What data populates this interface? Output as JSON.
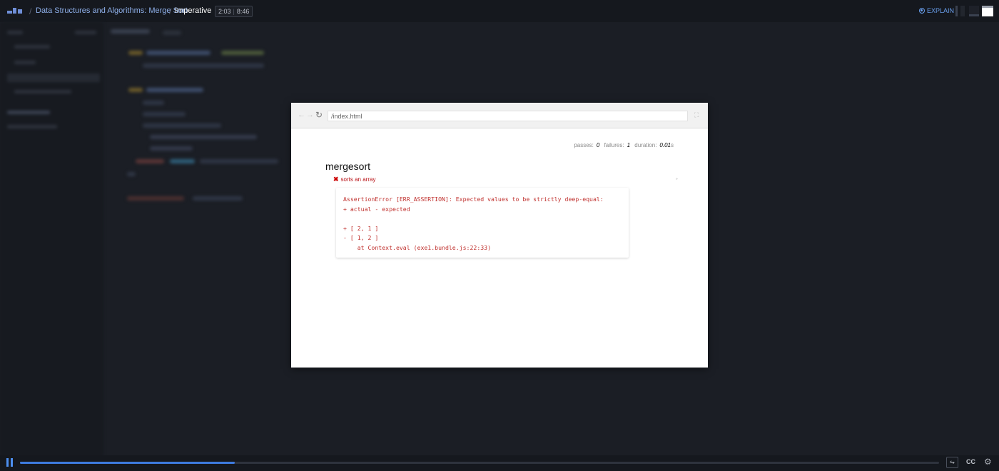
{
  "header": {
    "course_title": "Data Structures and Algorithms: Merge Sort",
    "lesson_title": "Imperative",
    "current_time": "2:03",
    "total_time": "8:46",
    "explain_label": "EXPLAIN",
    "separator": "/"
  },
  "browser": {
    "url": "/index.html",
    "stats": {
      "passes_label": "passes:",
      "passes": "0",
      "failures_label": "failures:",
      "failures": "1",
      "duration_label": "duration:",
      "duration": "0.01",
      "duration_unit": "s"
    },
    "suite_title": "mergesort",
    "test_title": "sorts an array",
    "error_text": "AssertionError [ERR_ASSERTION]: Expected values to be strictly deep-equal:\n+ actual - expected\n\n+ [ 2, 1 ]\n- [ 1, 2 ]\n    at Context.eval (exe1.bundle.js:22:33)"
  },
  "player": {
    "progress": 0.234,
    "cc_label": "CC",
    "colors": {
      "accent": "#3e7ce0",
      "error": "#c0312e",
      "link": "#8fb0ea"
    }
  }
}
